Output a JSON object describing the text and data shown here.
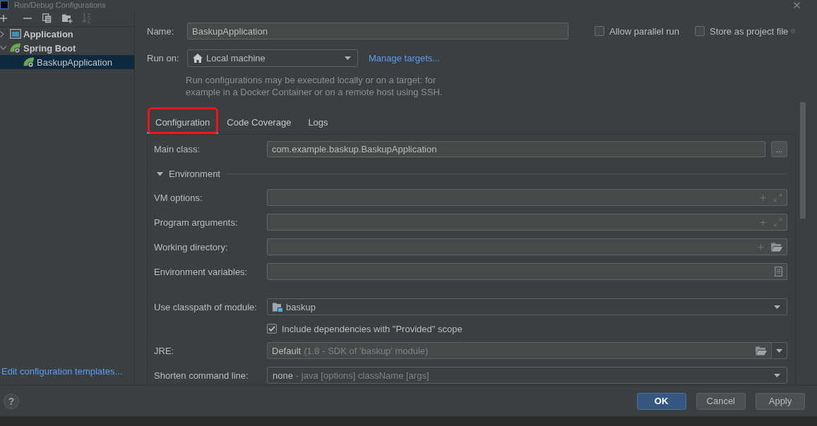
{
  "window": {
    "title": "Run/Debug Configurations"
  },
  "sidebar": {
    "toolbar": [
      {
        "kind": "add",
        "disabled": false
      },
      {
        "kind": "remove",
        "disabled": false
      },
      {
        "kind": "copy",
        "disabled": false
      },
      {
        "kind": "folder",
        "disabled": false
      },
      {
        "kind": "sort",
        "disabled": true
      }
    ],
    "tree": [
      {
        "label": "Application",
        "kind": "application",
        "expanded": false,
        "selected": false
      },
      {
        "label": "Spring Boot",
        "kind": "spring",
        "expanded": true,
        "selected": false,
        "children": [
          {
            "label": "BaskupApplication",
            "kind": "spring",
            "selected": true
          }
        ]
      }
    ],
    "templates_link": "Edit configuration templates..."
  },
  "header": {
    "name": {
      "label": "Name:",
      "value": "BaskupApplication"
    },
    "options": [
      {
        "label": "Allow parallel run",
        "checked": false
      },
      {
        "label": "Store as project file",
        "checked": false
      }
    ],
    "run_on": {
      "label": "Run on:",
      "value": "Local machine",
      "link": "Manage targets..."
    },
    "hint": "Run configurations may be executed locally or on a target: for\nexample in a Docker Container or on a remote host using SSH."
  },
  "tabs": [
    {
      "label": "Configuration",
      "selected": true,
      "highlighted": true
    },
    {
      "label": "Code Coverage",
      "selected": false,
      "highlighted": false
    },
    {
      "label": "Logs",
      "selected": false,
      "highlighted": false
    }
  ],
  "configuration": {
    "main_class": {
      "label": "Main class:",
      "value": "com.example.baskup.BaskupApplication",
      "button": "..."
    },
    "section": {
      "label": "Environment",
      "expanded": true
    },
    "fields": [
      {
        "label": "VM options:",
        "kind": "expandable"
      },
      {
        "label": "Program arguments:",
        "kind": "expandable"
      },
      {
        "label": "Working directory:",
        "kind": "directory"
      },
      {
        "label": "Environment variables:",
        "kind": "variables"
      }
    ],
    "module": {
      "label": "Use classpath of module:",
      "value": "baskup"
    },
    "include_provided": {
      "label": "Include dependencies with \"Provided\" scope",
      "checked": true
    },
    "jre": {
      "label": "JRE:",
      "value": "Default",
      "detail": "(1.8 - SDK of 'baskup' module)"
    },
    "shorten": {
      "label": "Shorten command line:",
      "value": "none",
      "detail": "- java [options] className [args]"
    }
  },
  "footer": {
    "help": "?",
    "buttons": [
      {
        "label": "OK",
        "kind": "primary"
      },
      {
        "label": "Cancel",
        "kind": "default"
      },
      {
        "label": "Apply",
        "kind": "default"
      }
    ]
  }
}
